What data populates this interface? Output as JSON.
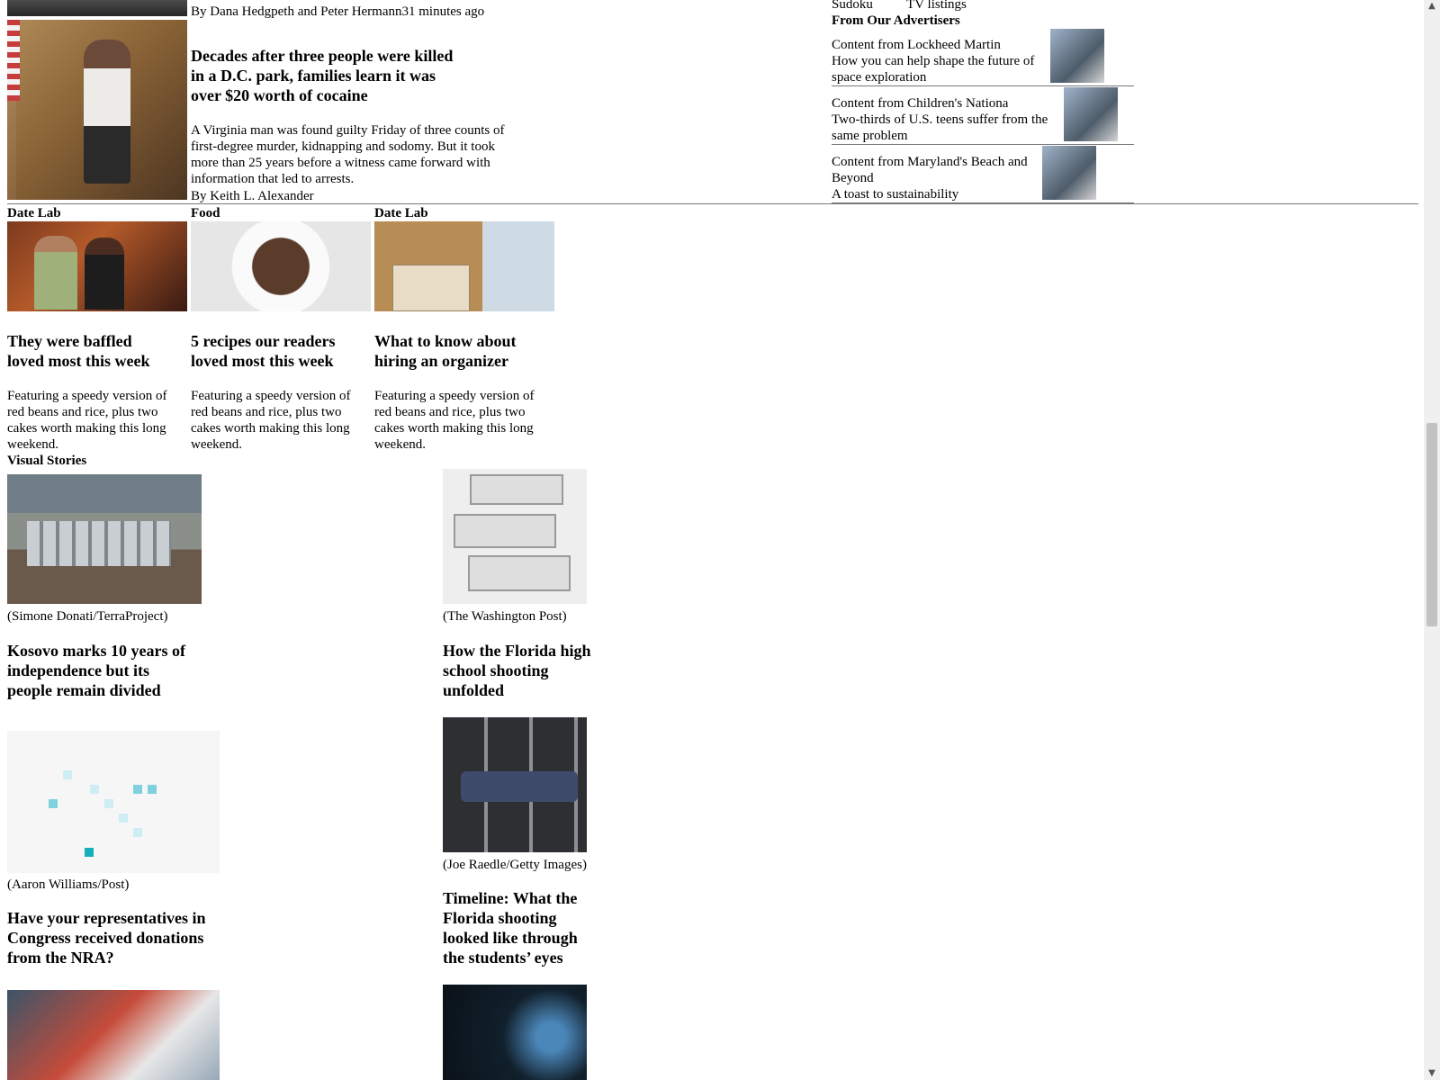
{
  "top_story": {
    "byline_top": "By Dana Hedgpeth and Peter Hermann",
    "time_ago": "31 minutes ago",
    "headline": "Decades after three people were killed in a D.C. park, families learn it was over $20 worth of cocaine",
    "blurb": "A Virginia man was found guilty Friday of three counts of first-degree murder, kidnapping and sodomy. But it took more than 25 years before a witness came forward with information that led to arrests.",
    "byline": "By Keith L. Alexander"
  },
  "right_rail": {
    "links": [
      "Sudoku",
      "TV listings"
    ],
    "advertisers_heading": "From Our Advertisers",
    "ads": [
      {
        "sponsor": "Content from Lockheed Martin",
        "title": "How you can help shape the future of space exploration"
      },
      {
        "sponsor": "Content from Children's Nationa",
        "title": "Two-thirds of U.S. teens suffer from the same problem"
      },
      {
        "sponsor": "Content from Maryland's Beach and Beyond",
        "title": "A toast to sustainability"
      }
    ]
  },
  "features": [
    {
      "section": "Date Lab",
      "headline": "They were baffled loved most this week",
      "blurb": "Featuring a speedy version of red beans and rice, plus two cakes worth making this long weekend."
    },
    {
      "section": "Food",
      "headline": "5 recipes our readers loved most this week",
      "blurb": "Featuring a speedy version of red beans and rice, plus two cakes worth making this long weekend."
    },
    {
      "section": "Date Lab",
      "headline": "What to know about hiring an organizer",
      "blurb": "Featuring a speedy version of red beans and rice, plus two cakes worth making this long weekend."
    }
  ],
  "visual_stories": {
    "heading": "Visual Stories",
    "items": [
      {
        "credit": "(Simone Donati/TerraProject)",
        "headline": "Kosovo marks 10 years of independence but its people remain divided"
      },
      {
        "credit": "(The Washington Post)",
        "headline": "How the Florida high school shooting unfolded"
      },
      {
        "credit": "(Aaron Williams/Post)",
        "headline": "Have your representatives in Congress received donations from the NRA?"
      },
      {
        "credit": "(Joe Raedle/Getty Images)",
        "headline": "Timeline: What the Florida shooting looked like through the students’ eyes"
      }
    ]
  },
  "colors": {
    "rule": "#777777",
    "scrollbar_track": "#f0f0f0",
    "scrollbar_thumb": "#c2c2c2"
  }
}
